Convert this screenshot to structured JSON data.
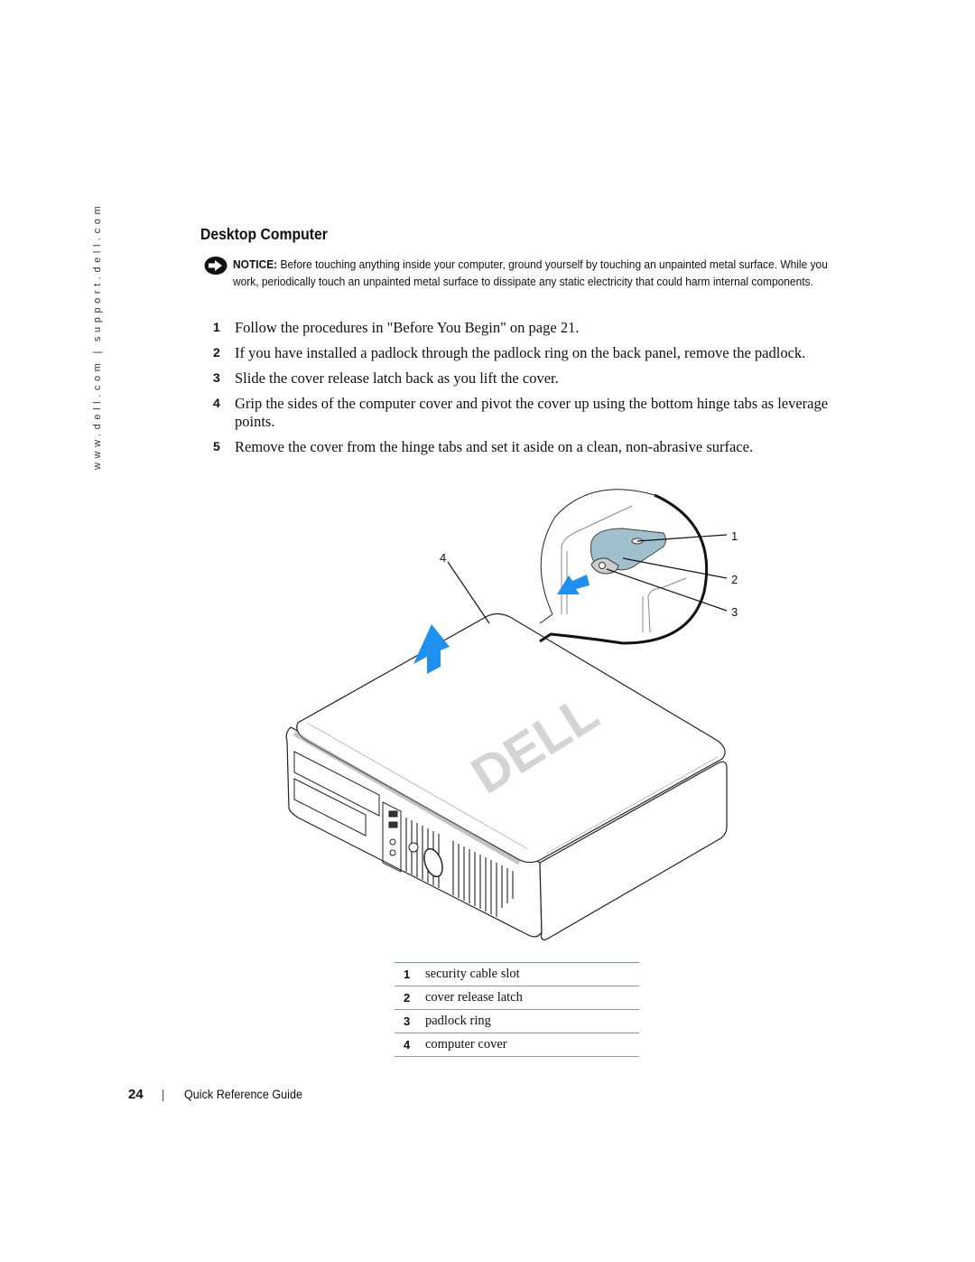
{
  "sidebar": {
    "url_primary": "www.dell.com",
    "separator": "|",
    "url_secondary": "support.dell.com"
  },
  "section": {
    "title": "Desktop Computer"
  },
  "notice": {
    "icon": "notice-arrow-icon",
    "label": "NOTICE:",
    "text": "Before touching anything inside your computer, ground yourself by touching an unpainted metal surface. While you work, periodically touch an unpainted metal surface to dissipate any static electricity that could harm internal components."
  },
  "steps": [
    {
      "num": "1",
      "text": "Follow the procedures in \"Before You Begin\" on page 21."
    },
    {
      "num": "2",
      "text": "If you have installed a padlock through the padlock ring on the back panel, remove the padlock."
    },
    {
      "num": "3",
      "text": "Slide the cover release latch back as you lift the cover."
    },
    {
      "num": "4",
      "text": "Grip the sides of the computer cover and pivot the cover up using the bottom hinge tabs as leverage points."
    },
    {
      "num": "5",
      "text": "Remove the cover from the hinge tabs and set it aside on a clean, non-abrasive surface."
    }
  ],
  "figure": {
    "callouts": [
      "1",
      "2",
      "3",
      "4"
    ],
    "logo_text": "DELL",
    "arrow_color": "#1e90f0",
    "latch_color": "#9fc0cc"
  },
  "legend": [
    {
      "num": "1",
      "label": "security cable slot"
    },
    {
      "num": "2",
      "label": "cover release latch"
    },
    {
      "num": "3",
      "label": "padlock ring"
    },
    {
      "num": "4",
      "label": "computer cover"
    }
  ],
  "footer": {
    "page_number": "24",
    "separator": "|",
    "guide_title": "Quick Reference Guide"
  }
}
